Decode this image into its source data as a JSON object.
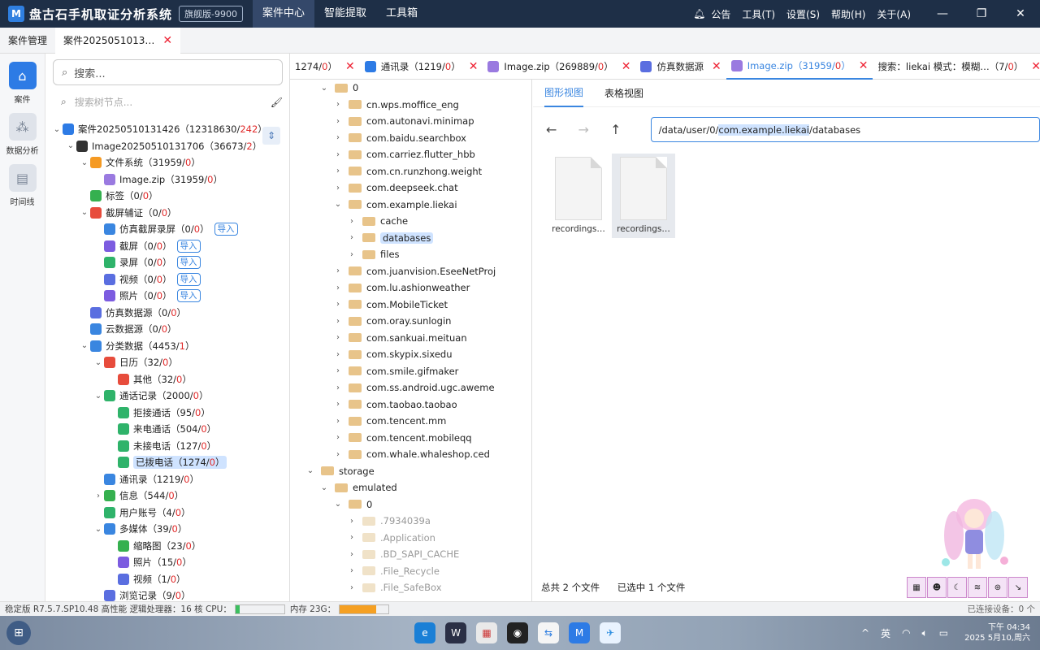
{
  "app": {
    "logo": "M",
    "title": "盘古石手机取证分析系统",
    "edition": "旗舰版-9900",
    "nav": [
      "案件中心",
      "智能提取",
      "工具箱"
    ],
    "menus": {
      "notice": "公告",
      "tools": "工具(T)",
      "settings": "设置(S)",
      "help": "帮助(H)",
      "about": "关于(A)"
    }
  },
  "case_tabs": [
    {
      "label": "案件管理"
    },
    {
      "label": "案件2025051013…"
    }
  ],
  "rail": [
    {
      "label": "案件",
      "icon": "home-icon"
    },
    {
      "label": "数据分析",
      "icon": "analysis-icon"
    },
    {
      "label": "时间线",
      "icon": "timeline-icon"
    }
  ],
  "left_panel": {
    "search_placeholder": "搜索...",
    "tree_search_placeholder": "搜索树节点...",
    "import_label": "导入"
  },
  "tree": [
    {
      "label": "案件20250510131426（12318630/",
      "red": "242",
      "tail": "）",
      "depth": 0,
      "arrow": "v",
      "color": "#2d7be5"
    },
    {
      "label": "Image20250510131706（36673/",
      "red": "2",
      "tail": "）",
      "depth": 1,
      "arrow": "v",
      "color": "#333"
    },
    {
      "label": "文件系统（31959/",
      "red": "0",
      "tail": "）",
      "depth": 2,
      "arrow": "v",
      "color": "#f59a23"
    },
    {
      "label": "Image.zip（31959/",
      "red": "0",
      "tail": "）",
      "depth": 3,
      "arrow": "",
      "color": "#9a7ae0"
    },
    {
      "label": "标签（0/",
      "red": "0",
      "tail": "）",
      "depth": 2,
      "arrow": "",
      "color": "#35b04f"
    },
    {
      "label": "截屏辅证（0/",
      "red": "0",
      "tail": "）",
      "depth": 2,
      "arrow": "v",
      "color": "#e74c3c"
    },
    {
      "label": "仿真截屏录屏（0/",
      "red": "0",
      "tail": "）",
      "depth": 3,
      "arrow": "",
      "color": "#3a86e0",
      "import": true
    },
    {
      "label": "截屏（0/",
      "red": "0",
      "tail": "）",
      "depth": 3,
      "arrow": "",
      "color": "#7c5ce0",
      "import": true
    },
    {
      "label": "录屏（0/",
      "red": "0",
      "tail": "）",
      "depth": 3,
      "arrow": "",
      "color": "#2fb36a",
      "import": true
    },
    {
      "label": "视频（0/",
      "red": "0",
      "tail": "）",
      "depth": 3,
      "arrow": "",
      "color": "#5a6ee0",
      "import": true
    },
    {
      "label": "照片（0/",
      "red": "0",
      "tail": "）",
      "depth": 3,
      "arrow": "",
      "color": "#7c5ce0",
      "import": true
    },
    {
      "label": "仿真数据源（0/",
      "red": "0",
      "tail": "）",
      "depth": 2,
      "arrow": "",
      "color": "#5a6ee0"
    },
    {
      "label": "云数据源（0/",
      "red": "0",
      "tail": "）",
      "depth": 2,
      "arrow": "",
      "color": "#3a86e0"
    },
    {
      "label": "分类数据（4453/",
      "red": "1",
      "tail": "）",
      "depth": 2,
      "arrow": "v",
      "color": "#3a86e0"
    },
    {
      "label": "日历（32/",
      "red": "0",
      "tail": "）",
      "depth": 3,
      "arrow": "v",
      "color": "#e74c3c"
    },
    {
      "label": "其他（32/",
      "red": "0",
      "tail": "）",
      "depth": 4,
      "arrow": "",
      "color": "#e74c3c"
    },
    {
      "label": "通话记录（2000/",
      "red": "0",
      "tail": "）",
      "depth": 3,
      "arrow": "v",
      "color": "#2fb36a"
    },
    {
      "label": "拒接通话（95/",
      "red": "0",
      "tail": "）",
      "depth": 4,
      "arrow": "",
      "color": "#2fb36a"
    },
    {
      "label": "来电通话（504/",
      "red": "0",
      "tail": "）",
      "depth": 4,
      "arrow": "",
      "color": "#2fb36a"
    },
    {
      "label": "未接电话（127/",
      "red": "0",
      "tail": "）",
      "depth": 4,
      "arrow": "",
      "color": "#2fb36a"
    },
    {
      "label": "已拨电话（1274/",
      "red": "0",
      "tail": "）",
      "depth": 4,
      "arrow": "",
      "color": "#2fb36a",
      "selected": true
    },
    {
      "label": "通讯录（1219/",
      "red": "0",
      "tail": "）",
      "depth": 3,
      "arrow": "",
      "color": "#3a86e0"
    },
    {
      "label": "信息（544/",
      "red": "0",
      "tail": "）",
      "depth": 3,
      "arrow": ">",
      "color": "#35b04f"
    },
    {
      "label": "用户账号（4/",
      "red": "0",
      "tail": "）",
      "depth": 3,
      "arrow": "",
      "color": "#2fb36a"
    },
    {
      "label": "多媒体（39/",
      "red": "0",
      "tail": "）",
      "depth": 3,
      "arrow": "v",
      "color": "#3a86e0"
    },
    {
      "label": "缩略图（23/",
      "red": "0",
      "tail": "）",
      "depth": 4,
      "arrow": "",
      "color": "#35b04f"
    },
    {
      "label": "照片（15/",
      "red": "0",
      "tail": "）",
      "depth": 4,
      "arrow": "",
      "color": "#7c5ce0"
    },
    {
      "label": "视频（1/",
      "red": "0",
      "tail": "）",
      "depth": 4,
      "arrow": "",
      "color": "#5a6ee0"
    },
    {
      "label": "浏览记录（9/",
      "red": "0",
      "tail": "）",
      "depth": 3,
      "arrow": "",
      "color": "#5a6ee0"
    }
  ],
  "file_tabs": [
    {
      "label": "1274/",
      "red": "0",
      "tail": "）",
      "icon": "none"
    },
    {
      "label": "通讯录（1219/",
      "red": "0",
      "tail": "）",
      "icon": "#2d7be5"
    },
    {
      "label": "Image.zip（269889/",
      "red": "0",
      "tail": "）",
      "icon": "#9a7ae0"
    },
    {
      "label": "仿真数据源",
      "red": "",
      "tail": "",
      "icon": "#5a6ee0"
    },
    {
      "label": "Image.zip（31959/",
      "red": "0",
      "tail": "）",
      "icon": "#9a7ae0",
      "active": true
    },
    {
      "label": "搜索：liekai  模式：模糊…（7/",
      "red": "0",
      "tail": "）",
      "icon": "none"
    }
  ],
  "dir_tree": [
    {
      "label": "0",
      "depth": 1,
      "arrow": "v"
    },
    {
      "label": "cn.wps.moffice_eng",
      "depth": 2,
      "arrow": ">"
    },
    {
      "label": "com.autonavi.minimap",
      "depth": 2,
      "arrow": ">"
    },
    {
      "label": "com.baidu.searchbox",
      "depth": 2,
      "arrow": ">"
    },
    {
      "label": "com.carriez.flutter_hbb",
      "depth": 2,
      "arrow": ">"
    },
    {
      "label": "com.cn.runzhong.weight",
      "depth": 2,
      "arrow": ">"
    },
    {
      "label": "com.deepseek.chat",
      "depth": 2,
      "arrow": ">"
    },
    {
      "label": "com.example.liekai",
      "depth": 2,
      "arrow": "v"
    },
    {
      "label": "cache",
      "depth": 3,
      "arrow": ">"
    },
    {
      "label": "databases",
      "depth": 3,
      "arrow": ">",
      "selected": true
    },
    {
      "label": "files",
      "depth": 3,
      "arrow": ">"
    },
    {
      "label": "com.juanvision.EseeNetProj",
      "depth": 2,
      "arrow": ">"
    },
    {
      "label": "com.lu.ashionweather",
      "depth": 2,
      "arrow": ">"
    },
    {
      "label": "com.MobileTicket",
      "depth": 2,
      "arrow": ">"
    },
    {
      "label": "com.oray.sunlogin",
      "depth": 2,
      "arrow": ">"
    },
    {
      "label": "com.sankuai.meituan",
      "depth": 2,
      "arrow": ">"
    },
    {
      "label": "com.skypix.sixedu",
      "depth": 2,
      "arrow": ">"
    },
    {
      "label": "com.smile.gifmaker",
      "depth": 2,
      "arrow": ">"
    },
    {
      "label": "com.ss.android.ugc.aweme",
      "depth": 2,
      "arrow": ">"
    },
    {
      "label": "com.taobao.taobao",
      "depth": 2,
      "arrow": ">"
    },
    {
      "label": "com.tencent.mm",
      "depth": 2,
      "arrow": ">"
    },
    {
      "label": "com.tencent.mobileqq",
      "depth": 2,
      "arrow": ">"
    },
    {
      "label": "com.whale.whaleshop.ced",
      "depth": 2,
      "arrow": ">"
    },
    {
      "label": "storage",
      "depth": 0,
      "arrow": "v"
    },
    {
      "label": "emulated",
      "depth": 1,
      "arrow": "v"
    },
    {
      "label": "0",
      "depth": 2,
      "arrow": "v"
    },
    {
      "label": ".7934039a",
      "depth": 3,
      "arrow": ">",
      "dim": true
    },
    {
      "label": ".Application",
      "depth": 3,
      "arrow": ">",
      "dim": true
    },
    {
      "label": ".BD_SAPI_CACHE",
      "depth": 3,
      "arrow": ">",
      "dim": true
    },
    {
      "label": ".File_Recycle",
      "depth": 3,
      "arrow": ">",
      "dim": true
    },
    {
      "label": ".File_SafeBox",
      "depth": 3,
      "arrow": ">",
      "dim": true
    }
  ],
  "viewer": {
    "tabs": [
      "图形视图",
      "表格视图"
    ],
    "path_prefix": "/data/user/0/",
    "path_highlight": "com.example.liekai",
    "path_suffix": "/databases",
    "files": [
      {
        "name": "recordings…",
        "selected": false
      },
      {
        "name": "recordings…",
        "selected": true
      }
    ],
    "total": "总共 2 个文件",
    "selected": "已选中 1 个文件"
  },
  "status": {
    "version": "稳定版 R7.5.7.SP10.48",
    "perf": "高性能",
    "cpu_label": "逻辑处理器：16 核 CPU：",
    "cpu_fill": 0.08,
    "mem_label": "内存 23G：",
    "mem_fill": 0.75,
    "devices": "已连接设备：0 个"
  },
  "taskbar": {
    "time": "下午 04:34",
    "date": "2025 5月10,周六"
  }
}
